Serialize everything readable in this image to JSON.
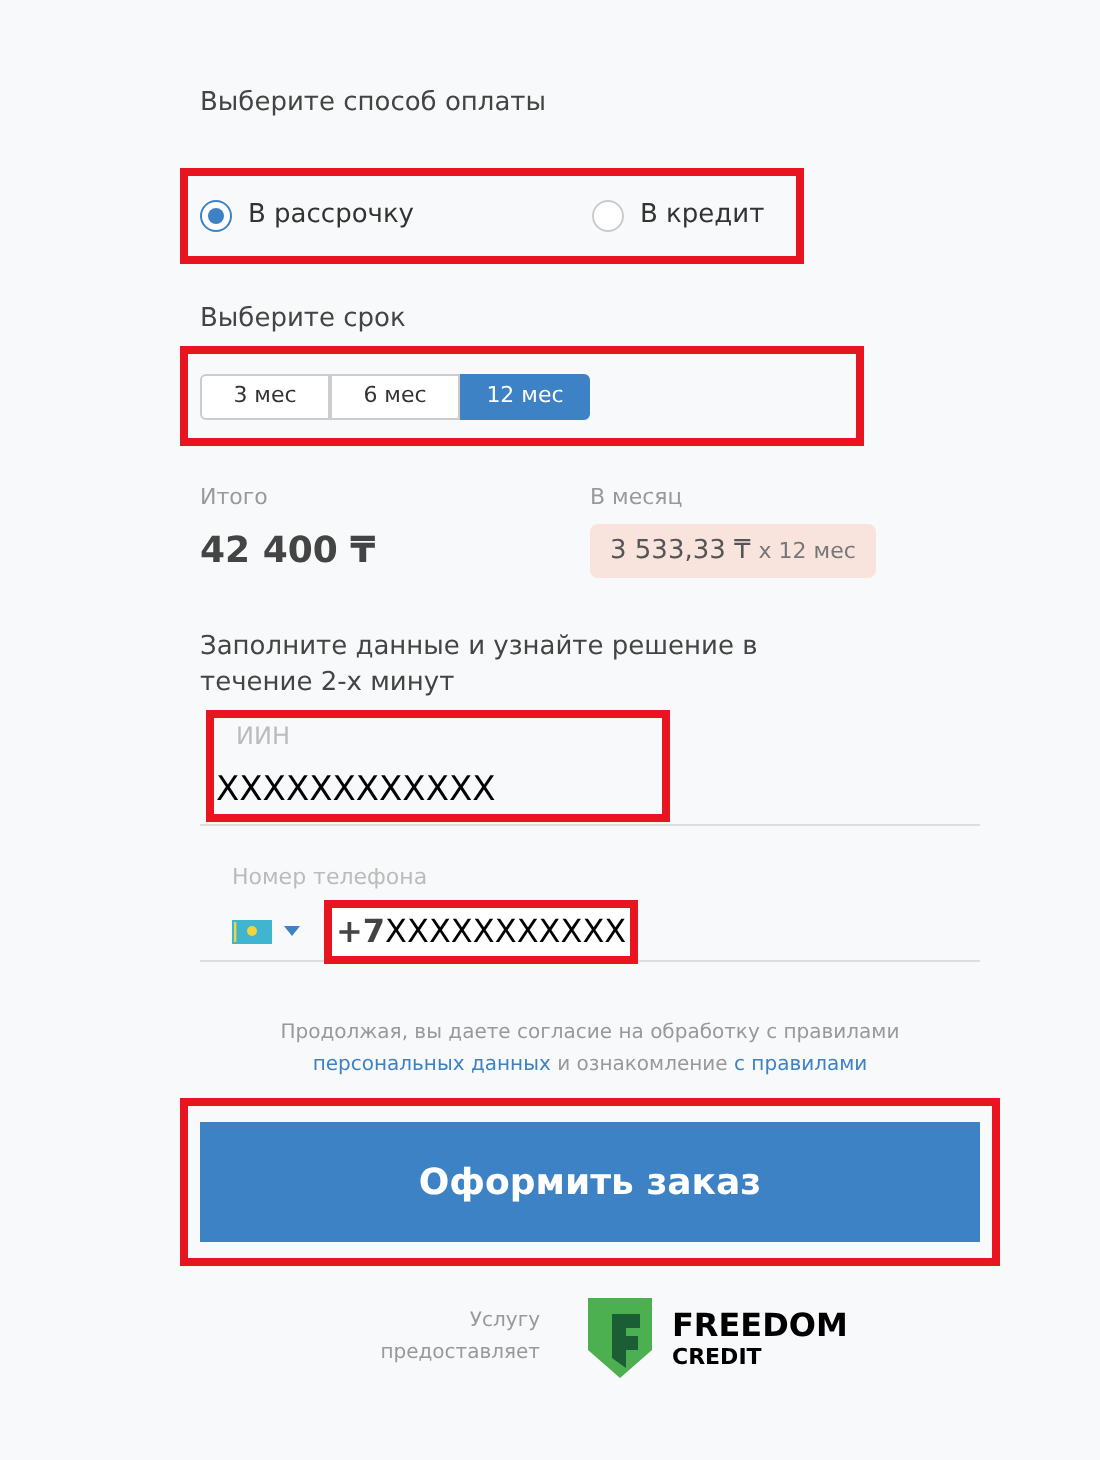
{
  "payment": {
    "title": "Выберите способ оплаты",
    "options": [
      {
        "label": "В рассрочку",
        "selected": true
      },
      {
        "label": "В кредит",
        "selected": false
      }
    ]
  },
  "term": {
    "title": "Выберите срок",
    "options": [
      {
        "label": "3 мес",
        "selected": false
      },
      {
        "label": "6 мес",
        "selected": false
      },
      {
        "label": "12 мес",
        "selected": true
      }
    ]
  },
  "summary": {
    "total_label": "Итого",
    "total": "42 400 ₸",
    "monthly_label": "В месяц",
    "monthly_amount": "3 533,33 ₸",
    "monthly_suffix": "x 12 мес"
  },
  "form": {
    "title": "Заполните данные и узнайте решение в течение 2-х минут",
    "iin": {
      "label": "ИИН",
      "value": "XXXXXXXXXXXX"
    },
    "phone": {
      "label": "Номер телефона",
      "prefix": "+7",
      "value": "XXXXXXXXXXX"
    }
  },
  "consent": {
    "text_before": "Продолжая, вы даете согласие на обработку с правилами",
    "link_1": "персональных данных",
    "text_middle": "и ознакомление",
    "link_2": "с правилами"
  },
  "submit": {
    "label": "Оформить заказ"
  },
  "provider": {
    "caption": "Услугу предоставляет",
    "brand_top": "FREEDOM",
    "brand_bottom": "CREDIT"
  }
}
